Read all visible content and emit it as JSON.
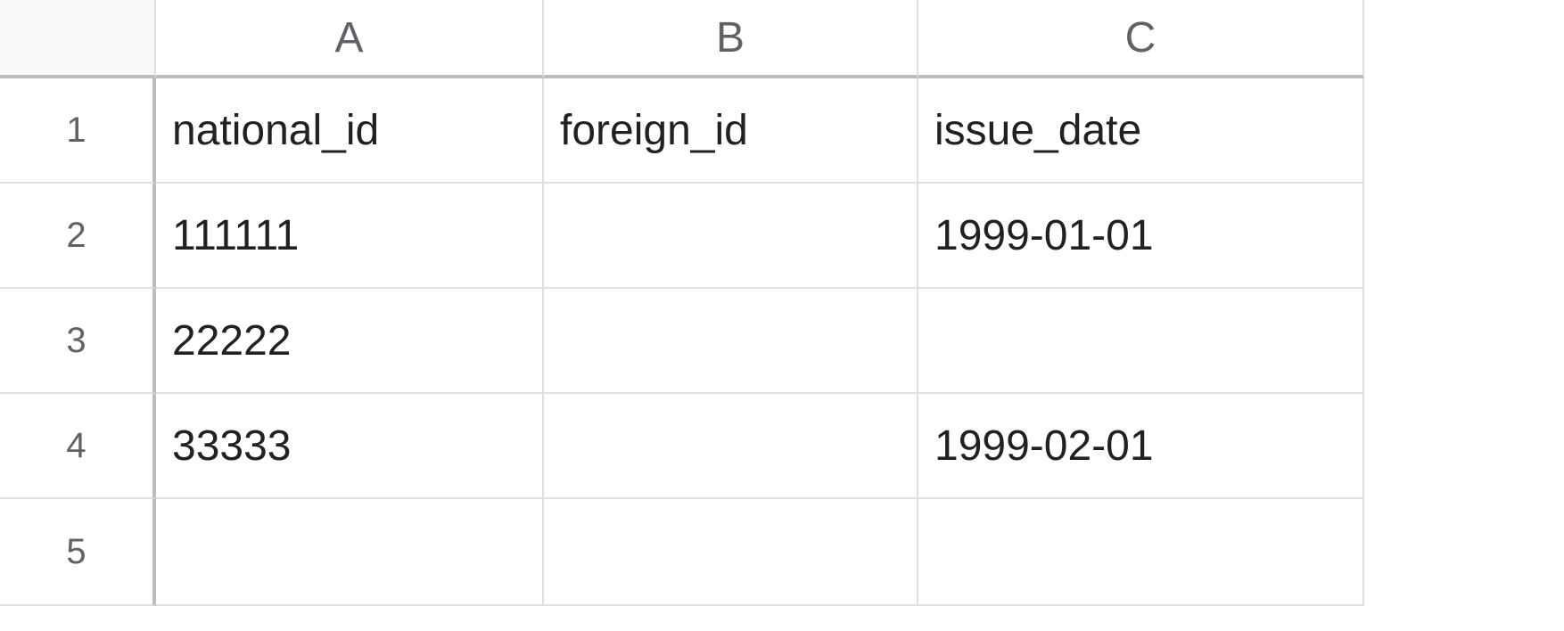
{
  "columns": [
    "A",
    "B",
    "C"
  ],
  "rowNumbers": [
    "1",
    "2",
    "3",
    "4",
    "5"
  ],
  "rows": [
    {
      "a": "national_id",
      "b": "foreign_id",
      "c": "issue_date"
    },
    {
      "a": "111111",
      "b": "",
      "c": "1999-01-01"
    },
    {
      "a": "22222",
      "b": "",
      "c": ""
    },
    {
      "a": "33333",
      "b": "",
      "c": "1999-02-01"
    },
    {
      "a": "",
      "b": "",
      "c": ""
    }
  ]
}
